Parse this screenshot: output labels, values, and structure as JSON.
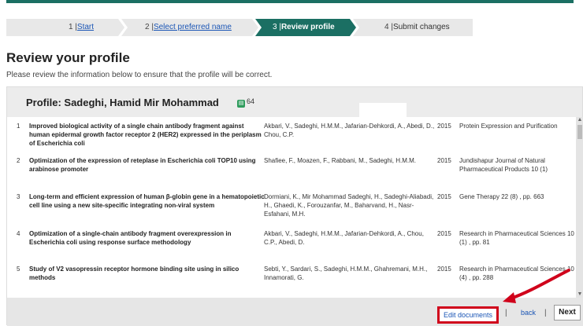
{
  "steps": [
    {
      "num": "1 |",
      "label": "Start"
    },
    {
      "num": "2 |",
      "label": "Select preferred name"
    },
    {
      "num": "3 |",
      "label": "Review profile"
    },
    {
      "num": "4 |",
      "label": "Submit changes"
    }
  ],
  "page": {
    "title": "Review your profile",
    "intro": "Please review the information below to ensure that the profile will be correct."
  },
  "profile": {
    "title": "Profile: Sadeghi, Hamid Mir Mohammad",
    "doc_count": "64"
  },
  "documents": [
    {
      "idx": "1",
      "title": "Improved biological activity of a single chain antibody fragment against human epidermal growth factor receptor 2 (HER2) expressed in the periplasm of Escherichia coli",
      "authors": "Akbari, V., Sadeghi, H.M.M., Jafarian-Dehkordi, A., Abedi, D., Chou, C.P.",
      "year": "2015",
      "journal": "Protein Expression and Purification"
    },
    {
      "idx": "2",
      "title": "Optimization of the expression of reteplase in Escherichia coli TOP10 using arabinose promoter",
      "authors": "Shafiee, F., Moazen, F., Rabbani, M., Sadeghi, H.M.M.",
      "year": "2015",
      "journal": "Jundishapur Journal of Natural Pharmaceutical Products 10 (1)"
    },
    {
      "idx": "3",
      "title": "Long-term and efficient expression of human β-globin gene in a hematopoietic cell line using a new site-specific integrating non-viral system",
      "authors": "Dormiani, K., Mir Mohammad Sadeghi, H., Sadeghi-Aliabadi, H., Ghaedi, K., Forouzanfar, M., Baharvand, H., Nasr-Esfahani, M.H.",
      "year": "2015",
      "journal": "Gene Therapy 22 (8) , pp. 663"
    },
    {
      "idx": "4",
      "title": "Optimization of a single-chain antibody fragment overexpression in Escherichia coli using response surface methodology",
      "authors": "Akbari, V., Sadeghi, H.M.M., Jafarian-Dehkordi, A., Chou, C.P., Abedi, D.",
      "year": "2015",
      "journal": "Research in Pharmaceutical Sciences 10 (1) , pp. 81"
    },
    {
      "idx": "5",
      "title": "Study of V2 vasopressin receptor hormone binding site using in silico methods",
      "authors": "Sebti, Y., Sardari, S., Sadeghi, H.M.M., Ghahremani, M.H., Innamorati, G.",
      "year": "2015",
      "journal": "Research in Pharmaceutical Sciences 10 (4) , pp. 288"
    }
  ],
  "footer": {
    "edit_label": "Edit documents",
    "sep": "|",
    "back_label": "back",
    "next_label": "Next"
  },
  "colors": {
    "accent": "#1b6f63",
    "highlight": "#d0021b",
    "link": "#1a55b5"
  }
}
